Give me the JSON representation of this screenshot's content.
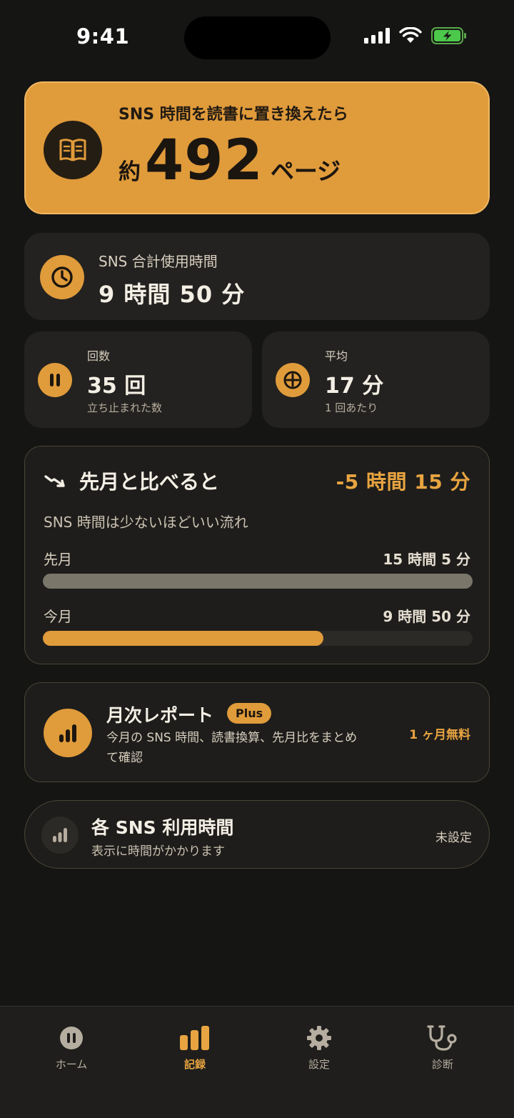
{
  "status_bar": {
    "time": "9:41",
    "icons": [
      "cellular-signal-icon",
      "wifi-icon",
      "battery-charging-icon"
    ]
  },
  "hero": {
    "icon": "book-icon",
    "title": "SNS 時間を読書に置き換えたら",
    "prefix": "約",
    "pages": "492",
    "suffix": "ページ"
  },
  "total_usage": {
    "icon": "clock-icon",
    "label": "SNS 合計使用時間",
    "value": "9 時間 50 分"
  },
  "count": {
    "icon": "pause-icon",
    "label": "回数",
    "value": "35 回",
    "sub": "立ち止まれた数"
  },
  "average": {
    "icon": "crosshair-icon",
    "label": "平均",
    "value": "17 分",
    "sub": "1 回あたり"
  },
  "comparison": {
    "icon": "trend-down-icon",
    "title": "先月と比べると",
    "delta": "-5 時間 15 分",
    "subtitle": "SNS 時間は少ないほどいい流れ",
    "rows": [
      {
        "label": "先月",
        "value": "15 時間 5 分",
        "fraction": 1.0,
        "color": "#7a766a"
      },
      {
        "label": "今月",
        "value": "9 時間 50 分",
        "fraction": 0.652,
        "color": "#e09b3b"
      }
    ]
  },
  "monthly_report": {
    "icon": "bar-chart-icon",
    "title": "月次レポート",
    "badge": "Plus",
    "description": "今月の SNS 時間、読書換算、先月比をまとめて確認",
    "free_label": "1 ヶ月無料"
  },
  "sns_usage": {
    "icon": "bar-chart-icon",
    "title": "各 SNS 利用時間",
    "subtitle": "表示に時間がかかります",
    "status": "未設定"
  },
  "tabbar": {
    "active_color": "#e8a441",
    "tabs": [
      {
        "label": "ホーム",
        "icon": "pause-circle-icon",
        "active": false
      },
      {
        "label": "記録",
        "icon": "bar-chart-icon",
        "active": true
      },
      {
        "label": "設定",
        "icon": "gear-icon",
        "active": false
      },
      {
        "label": "診断",
        "icon": "stethoscope-icon",
        "active": false
      }
    ]
  }
}
